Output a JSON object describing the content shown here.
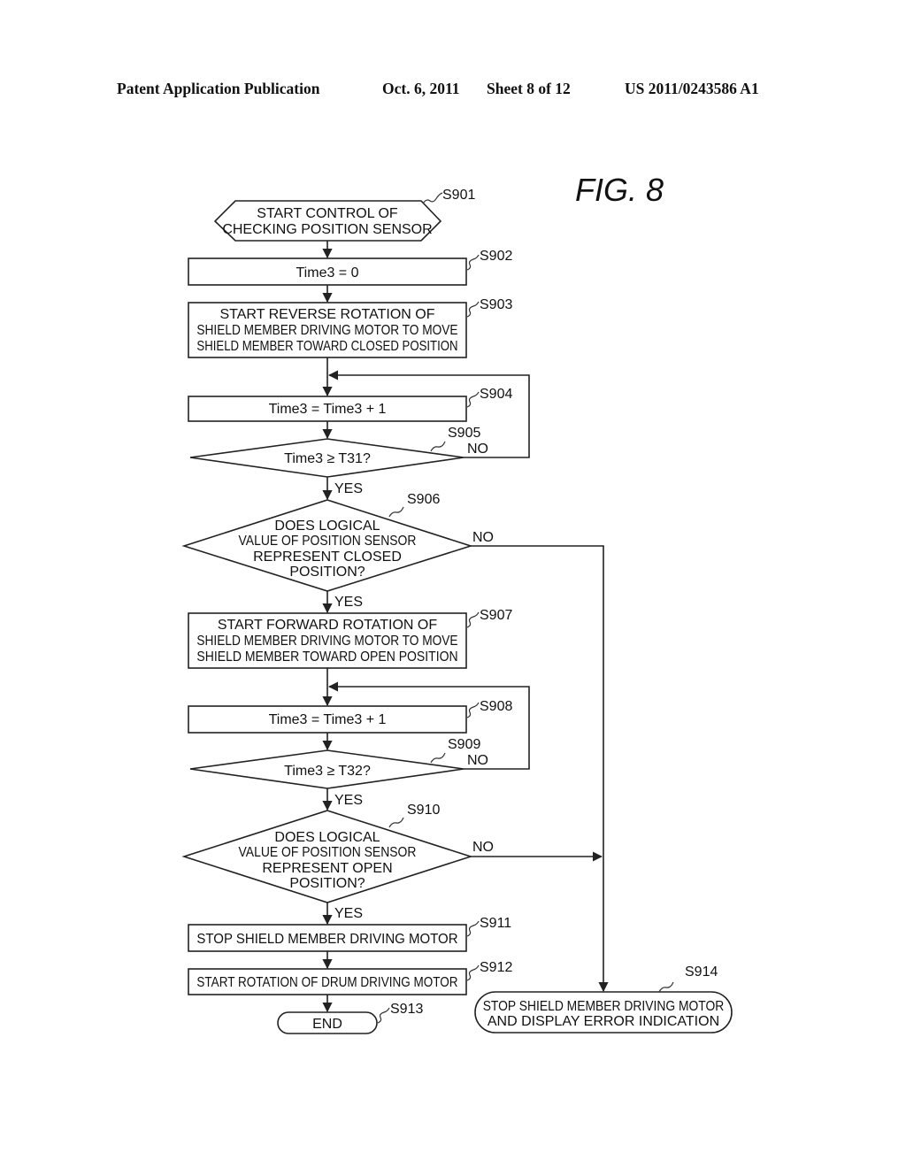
{
  "header": {
    "left": "Patent Application Publication",
    "date": "Oct. 6, 2011",
    "sheet": "Sheet 8 of 12",
    "number": "US 2011/0243586 A1"
  },
  "figure_label": "FIG.  8",
  "nodes": {
    "s901": {
      "ref": "S901",
      "type": "start-hexagon",
      "lines": [
        "START CONTROL OF",
        "CHECKING POSITION SENSOR"
      ]
    },
    "s902": {
      "ref": "S902",
      "type": "process",
      "lines": [
        "Time3 = 0"
      ]
    },
    "s903": {
      "ref": "S903",
      "type": "process",
      "lines": [
        "START REVERSE ROTATION OF",
        "SHIELD MEMBER DRIVING MOTOR TO MOVE",
        "SHIELD MEMBER TOWARD CLOSED POSITION"
      ]
    },
    "s904": {
      "ref": "S904",
      "type": "process",
      "lines": [
        "Time3 = Time3 + 1"
      ]
    },
    "s905": {
      "ref": "S905",
      "type": "decision",
      "lines": [
        "Time3 ≥ T31?"
      ]
    },
    "s906": {
      "ref": "S906",
      "type": "decision",
      "lines": [
        "DOES LOGICAL",
        "VALUE OF POSITION SENSOR",
        "REPRESENT CLOSED",
        "POSITION?"
      ]
    },
    "s907": {
      "ref": "S907",
      "type": "process",
      "lines": [
        "START FORWARD ROTATION OF",
        "SHIELD MEMBER DRIVING MOTOR TO MOVE",
        "SHIELD MEMBER TOWARD OPEN POSITION"
      ]
    },
    "s908": {
      "ref": "S908",
      "type": "process",
      "lines": [
        "Time3 = Time3 + 1"
      ]
    },
    "s909": {
      "ref": "S909",
      "type": "decision",
      "lines": [
        "Time3 ≥ T32?"
      ]
    },
    "s910": {
      "ref": "S910",
      "type": "decision",
      "lines": [
        "DOES LOGICAL",
        "VALUE OF POSITION SENSOR",
        "REPRESENT OPEN",
        "POSITION?"
      ]
    },
    "s911": {
      "ref": "S911",
      "type": "process",
      "lines": [
        "STOP SHIELD MEMBER DRIVING MOTOR"
      ]
    },
    "s912": {
      "ref": "S912",
      "type": "process",
      "lines": [
        "START ROTATION OF DRUM DRIVING MOTOR"
      ]
    },
    "s913": {
      "ref": "S913",
      "type": "terminal",
      "lines": [
        "END"
      ]
    },
    "s914": {
      "ref": "S914",
      "type": "terminal",
      "lines": [
        "STOP SHIELD MEMBER DRIVING MOTOR",
        "AND DISPLAY ERROR INDICATION"
      ]
    }
  },
  "edge_labels": {
    "yes": "YES",
    "no": "NO"
  },
  "edges": [
    {
      "from": "S901",
      "to": "S902"
    },
    {
      "from": "S902",
      "to": "S903"
    },
    {
      "from": "S903",
      "to": "S904"
    },
    {
      "from": "S904",
      "to": "S905"
    },
    {
      "from": "S905",
      "to": "S904",
      "label": "NO"
    },
    {
      "from": "S905",
      "to": "S906",
      "label": "YES"
    },
    {
      "from": "S906",
      "to": "S914",
      "label": "NO"
    },
    {
      "from": "S906",
      "to": "S907",
      "label": "YES"
    },
    {
      "from": "S907",
      "to": "S908"
    },
    {
      "from": "S908",
      "to": "S909"
    },
    {
      "from": "S909",
      "to": "S908",
      "label": "NO"
    },
    {
      "from": "S909",
      "to": "S910",
      "label": "YES"
    },
    {
      "from": "S910",
      "to": "S914",
      "label": "NO"
    },
    {
      "from": "S910",
      "to": "S911",
      "label": "YES"
    },
    {
      "from": "S911",
      "to": "S912"
    },
    {
      "from": "S912",
      "to": "S913"
    }
  ]
}
